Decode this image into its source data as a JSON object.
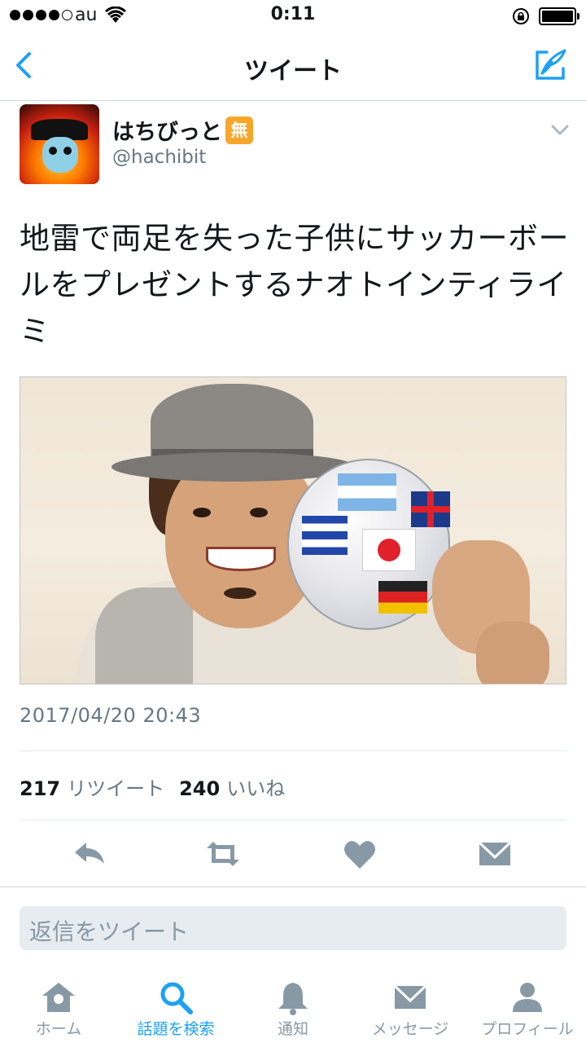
{
  "status_bar": {
    "carrier": "au",
    "time": "0:11"
  },
  "nav": {
    "title": "ツイート"
  },
  "tweet": {
    "display_name": "はちびっと",
    "badge": "無",
    "handle": "@hachibit",
    "text": "地雷で両足を失った子供にサッカーボールをプレゼントするナオトインティライミ",
    "timestamp": "2017/04/20 20:43",
    "retweet_count": "217",
    "retweet_label": "リツイート",
    "like_count": "240",
    "like_label": "いいね"
  },
  "reply": {
    "placeholder": "返信をツイート"
  },
  "tabs": [
    {
      "label": "ホーム",
      "icon": "home-icon"
    },
    {
      "label": "話題を検索",
      "icon": "search-icon",
      "active": true
    },
    {
      "label": "通知",
      "icon": "bell-icon"
    },
    {
      "label": "メッセージ",
      "icon": "envelope-icon"
    },
    {
      "label": "プロフィール",
      "icon": "person-icon"
    }
  ],
  "colors": {
    "accent": "#1da1f2",
    "muted": "#8899a6",
    "icon_gray": "#8899a6",
    "badge": "#f7a62a"
  }
}
